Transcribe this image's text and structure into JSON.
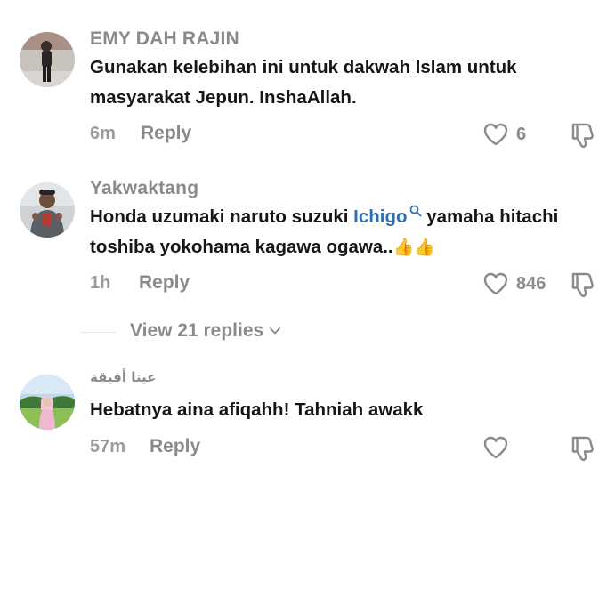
{
  "comments": [
    {
      "username": "EMY DAH RAJIN",
      "lines": [
        "Gunakan kelebihan ini untuk dakwah Islam untuk",
        "masyarakat Jepun. InshaAllah."
      ],
      "time": "6m",
      "reply_label": "Reply",
      "likes": "6"
    },
    {
      "username": "Yakwaktang",
      "line1_before": "Honda uzumaki naruto suzuki ",
      "mention": "Ichigo",
      "line1_after": " yamaha hitachi",
      "line2": "toshiba yokohama kagawa ogawa..",
      "line2_emoji": "👍👍",
      "time": "1h",
      "reply_label": "Reply",
      "likes": "846"
    },
    {
      "username": "عينا أفيقة",
      "lines": [
        "Hebatnya aina afiqahh! Tahniah awakk"
      ],
      "time": "57m",
      "reply_label": "Reply",
      "likes": ""
    }
  ],
  "view_replies_label": "View 21 replies",
  "icons": {
    "like": "heart-outline-icon",
    "dislike": "thumbs-down-icon",
    "chevron": "chevron-down-icon",
    "mention_search": "search-icon"
  },
  "colors": {
    "username": "#8a8a8a",
    "text": "#161616",
    "mention": "#2f6fb0",
    "meta": "#9b9b9b"
  }
}
